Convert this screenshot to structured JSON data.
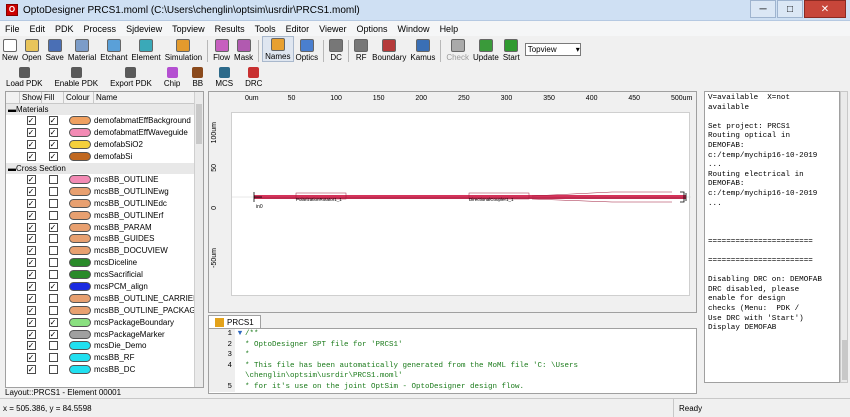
{
  "window": {
    "app_icon": "opto-designer-icon",
    "title": "OptoDesigner  PRCS1.moml (C:\\Users\\chenglin\\optsim\\usrdir\\PRCS1.moml)"
  },
  "menu": [
    "File",
    "Edit",
    "PDK",
    "Process",
    "Sjdeview",
    "Topview",
    "Results",
    "Tools",
    "Editor",
    "Viewer",
    "Options",
    "Window",
    "Help"
  ],
  "toolbar": {
    "buttons": [
      {
        "label": "New",
        "icon": "new-file-icon",
        "color": "#ffffff"
      },
      {
        "label": "Open",
        "icon": "folder-open-icon",
        "color": "#e8c45a"
      },
      {
        "label": "Save",
        "icon": "save-disk-icon",
        "color": "#4a6fb5"
      },
      {
        "label": "Material",
        "icon": "material-drop-icon",
        "color": "#7c9cc8"
      },
      {
        "label": "Etchant",
        "icon": "etchant-flask-icon",
        "color": "#5aa0d8"
      },
      {
        "label": "Element",
        "icon": "element-block-icon",
        "color": "#3aa9b8"
      },
      {
        "label": "Simulation",
        "icon": "simulation-grid-icon",
        "color": "#e39a2d"
      },
      {
        "label": "Flow",
        "icon": "flow-icon",
        "color": "#c65fbf"
      },
      {
        "label": "Mask",
        "icon": "mask-icon",
        "color": "#b15ab0"
      },
      {
        "label": "Names",
        "icon": "names-icon",
        "color": "#e8a030"
      },
      {
        "label": "Optics",
        "icon": "optics-icon",
        "color": "#4a7fcf"
      },
      {
        "label": "DC",
        "icon": "dc-icon",
        "color": "#777777"
      },
      {
        "label": "RF",
        "icon": "rf-icon",
        "color": "#777777"
      },
      {
        "label": "Boundary",
        "icon": "boundary-icon",
        "color": "#b53a3a"
      },
      {
        "label": "Kamus",
        "icon": "kamus-icon",
        "color": "#3a6fb5"
      },
      {
        "label": "Check",
        "icon": "check-icon",
        "color": "#aaaaaa"
      },
      {
        "label": "Update",
        "icon": "update-icon",
        "color": "#3a9a3a"
      },
      {
        "label": "Start",
        "icon": "start-icon",
        "color": "#2f9a2f"
      }
    ],
    "view_select": "Topview"
  },
  "toolbar2": [
    {
      "label": "Load PDK",
      "icon": "load-pdk-icon",
      "color": "#5a5a5a"
    },
    {
      "label": "Enable PDK",
      "icon": "enable-pdk-icon",
      "color": "#5a5a5a"
    },
    {
      "label": "Export PDK",
      "icon": "export-pdk-icon",
      "color": "#5a5a5a"
    },
    {
      "label": "Chip",
      "icon": "chip-icon",
      "color": "#b44fd1"
    },
    {
      "label": "BB",
      "icon": "bb-icon",
      "color": "#8b4a1c"
    },
    {
      "label": "MCS",
      "icon": "mcs-icon",
      "color": "#2d6a8a"
    },
    {
      "label": "DRC",
      "icon": "drc-icon",
      "color": "#c83030"
    }
  ],
  "layers": {
    "headers": [
      "Show",
      "Fill",
      "Colour",
      "Name"
    ],
    "groups": [
      {
        "name": "Materials",
        "items": [
          {
            "show": true,
            "fill": true,
            "color": "#f0a060",
            "name": "demofabmatEffBackground"
          },
          {
            "show": true,
            "fill": true,
            "color": "#f28ab4",
            "name": "demofabmatEffWaveguide"
          },
          {
            "show": true,
            "fill": true,
            "color": "#f5d03b",
            "name": "demofabSiO2"
          },
          {
            "show": true,
            "fill": true,
            "color": "#c06820",
            "name": "demofabSi"
          }
        ]
      },
      {
        "name": "Cross Section",
        "items": [
          {
            "show": true,
            "fill": false,
            "color": "#f28ab4",
            "name": "mcsBB_OUTLINE"
          },
          {
            "show": true,
            "fill": false,
            "color": "#e8a070",
            "name": "mcsBB_OUTLINEwg"
          },
          {
            "show": true,
            "fill": false,
            "color": "#e8a070",
            "name": "mcsBB_OUTLINEdc"
          },
          {
            "show": true,
            "fill": false,
            "color": "#e8a070",
            "name": "mcsBB_OUTLINErf"
          },
          {
            "show": true,
            "fill": true,
            "color": "#e8a070",
            "name": "mcsBB_PARAM"
          },
          {
            "show": true,
            "fill": false,
            "color": "#e8a070",
            "name": "mcsBB_GUIDES"
          },
          {
            "show": true,
            "fill": false,
            "color": "#e8a070",
            "name": "mcsBB_DOCUVIEW"
          },
          {
            "show": true,
            "fill": false,
            "color": "#2a8a2a",
            "name": "mcsDiceline"
          },
          {
            "show": true,
            "fill": false,
            "color": "#2a8a2a",
            "name": "mcsSacrificial"
          },
          {
            "show": true,
            "fill": true,
            "color": "#1a2ae0",
            "name": "mcsPCM_align"
          },
          {
            "show": true,
            "fill": false,
            "color": "#e8a070",
            "name": "mcsBB_OUTLINE_CARRIER"
          },
          {
            "show": true,
            "fill": false,
            "color": "#e8a070",
            "name": "mcsBB_OUTLINE_PACKAGE"
          },
          {
            "show": true,
            "fill": true,
            "color": "#8ae080",
            "name": "mcsPackageBoundary"
          },
          {
            "show": true,
            "fill": true,
            "color": "#a0a0a0",
            "name": "mcsPackageMarker"
          },
          {
            "show": true,
            "fill": false,
            "color": "#20e0f0",
            "name": "mcsDie_Demo"
          },
          {
            "show": true,
            "fill": false,
            "color": "#20e0f0",
            "name": "mcsBB_RF"
          },
          {
            "show": true,
            "fill": false,
            "color": "#20e0f0",
            "name": "mcsBB_DC"
          }
        ]
      }
    ],
    "footer": "Layout::PRCS1 - Element 00001"
  },
  "canvas": {
    "xticks": [
      "0um",
      "50",
      "100",
      "150",
      "200",
      "250",
      "300",
      "350",
      "400",
      "450",
      "500um"
    ],
    "yticks": [
      "100um",
      "50",
      "0",
      "-50um"
    ],
    "labels": {
      "left": "in0",
      "mid1": "PolarizationRotator1_1",
      "mid2": "DirectionalCoupler1_1"
    }
  },
  "tab": {
    "label": "PRCS1"
  },
  "editor": {
    "lines": [
      {
        "n": "1",
        "fold": "▼",
        "text": "/**"
      },
      {
        "n": "2",
        "fold": "",
        "text": " * OptoDesigner SPT file for 'PRCS1'"
      },
      {
        "n": "3",
        "fold": "",
        "text": " *"
      },
      {
        "n": "4",
        "fold": "",
        "text": " * This file has been automatically generated from the MoML file 'C:  \\Users"
      },
      {
        "n": "",
        "fold": "",
        "text": "\\chenglin\\optsim\\usrdir\\PRCS1.moml'"
      },
      {
        "n": "5",
        "fold": "",
        "text": " * for it's use on the joint OptSim - OptoDesigner design flow."
      }
    ]
  },
  "console": {
    "text": "V=available  X=not\navailable\n\nSet project: PRCS1\nRouting optical in\nDEMOFAB:\nc:/temp/mychip16-10-2019\n...\nRouting electrical in\nDEMOFAB:\nc:/temp/mychip16-10-2019\n...\n\n\n\n=======================\n\n=======================\n\nDisabling DRC on: DEMOFAB\nDRC disabled, please\nenable for design\nchecks (Menu:  PDK /\nUse DRC with 'Start')\nDisplay DEMOFAB"
  },
  "status": {
    "coords": "x = 505.386, y = 84.5598",
    "ready": "Ready"
  },
  "colors": {
    "waveguide": "#d4335a",
    "title_bg": "#cfe0f3"
  }
}
